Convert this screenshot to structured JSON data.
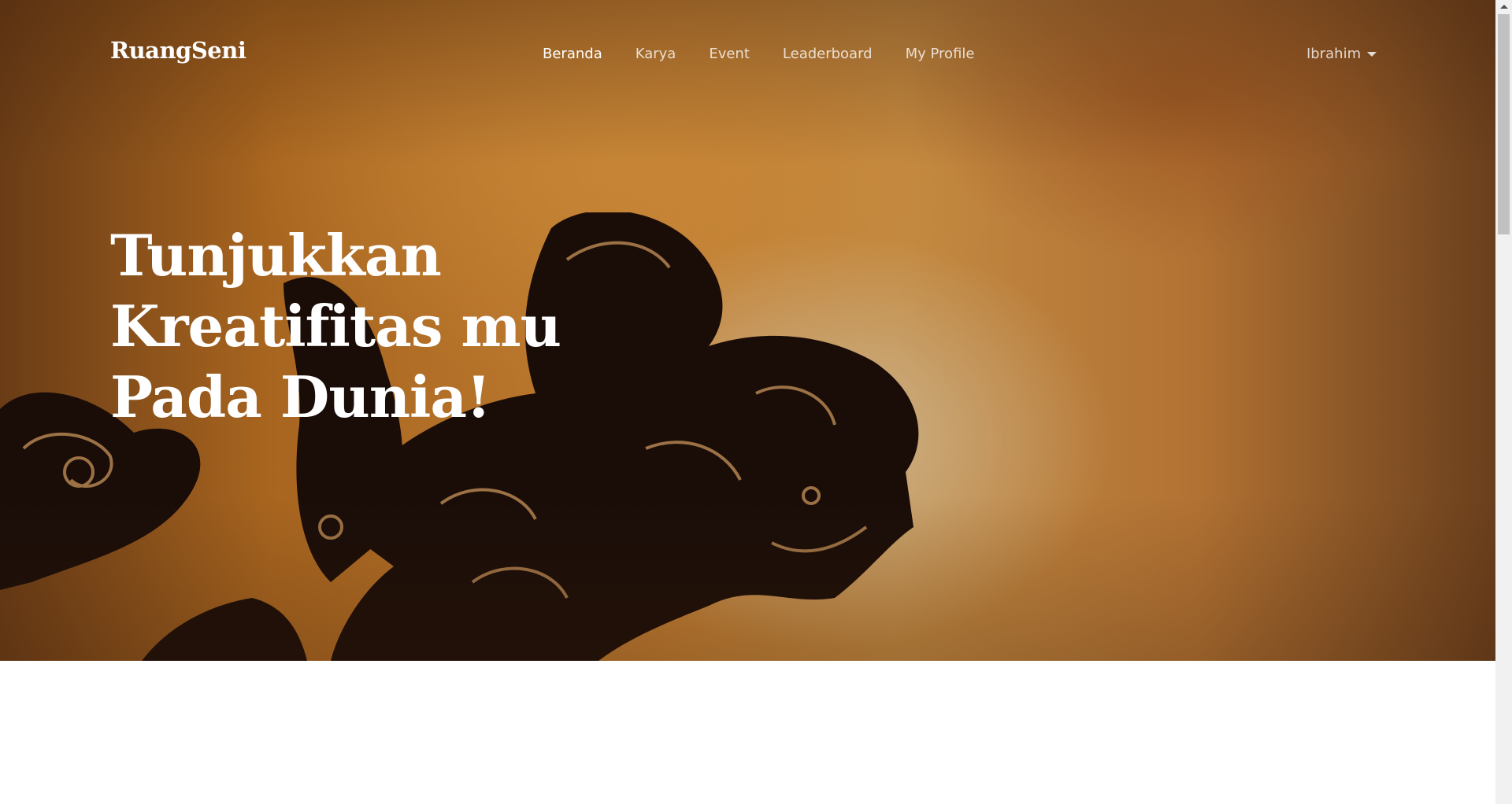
{
  "nav": {
    "brand": "RuangSeni",
    "links": [
      {
        "label": "Beranda",
        "active": true
      },
      {
        "label": "Karya",
        "active": false
      },
      {
        "label": "Event",
        "active": false
      },
      {
        "label": "Leaderboard",
        "active": false
      },
      {
        "label": "My Profile",
        "active": false
      }
    ],
    "user": {
      "name": "Ibrahim",
      "icon": "caret-down-icon"
    }
  },
  "hero": {
    "headline_lines": [
      "Tunjukkan",
      "Kreatifitas mu",
      "Pada Dunia!"
    ],
    "image": "wayang-silhouette",
    "colors": {
      "sky": "#c07d32",
      "silhouette": "#1a0d08"
    }
  }
}
